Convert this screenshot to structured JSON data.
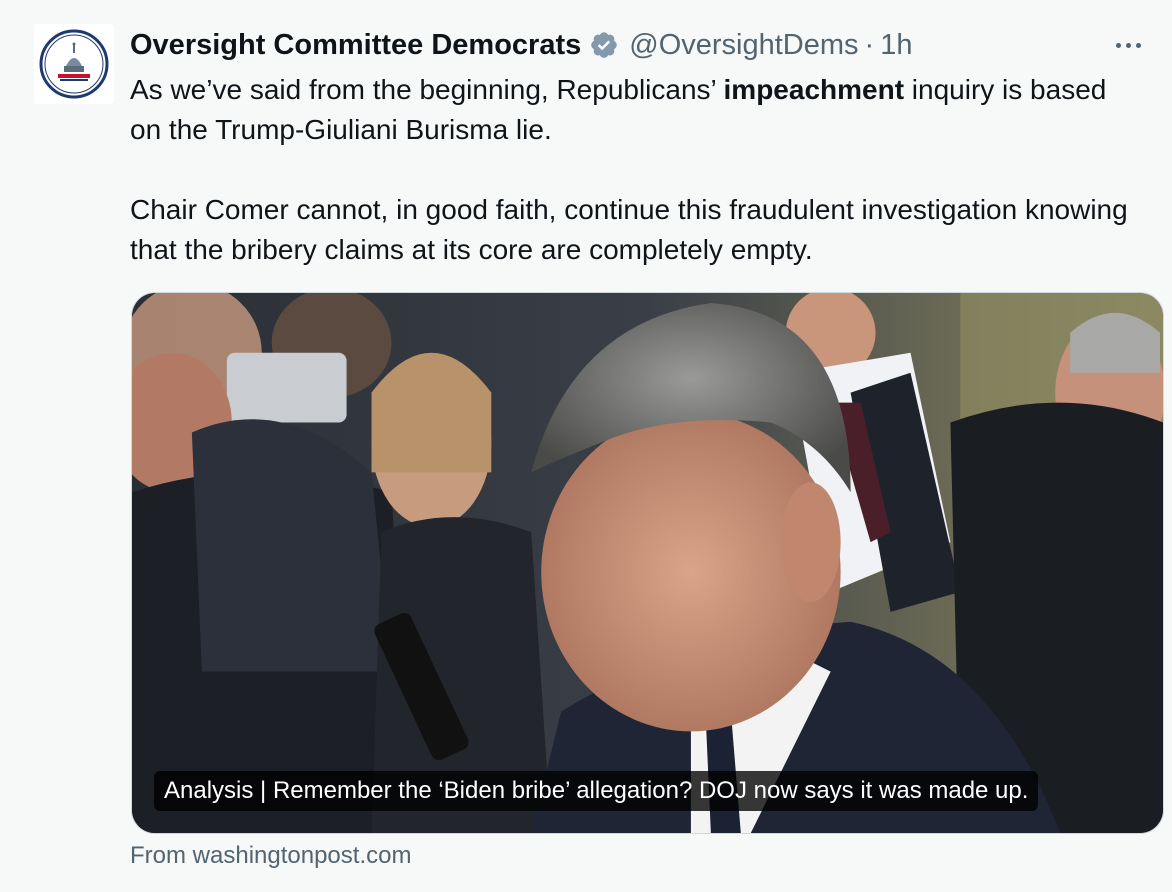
{
  "tweet": {
    "author": {
      "display_name": "Oversight Committee Democrats",
      "handle": "@OversightDems",
      "verified": true,
      "avatar_icon": "capitol-dome-seal-icon"
    },
    "separator": "·",
    "time": "1h",
    "text": {
      "para1_pre": "As we’ve said from the beginning, Republicans’ ",
      "para1_bold": "impeachment",
      "para1_post": " inquiry is based on the Trump-Giuliani Burisma lie.",
      "para2": "Chair Comer cannot, in good faith, continue this fraudulent investigation knowing that the bribery claims at its core are completely empty."
    },
    "card": {
      "title": "Analysis | Remember the ‘Biden bribe’ allegation? DOJ now says it was made up.",
      "source": "From washingtonpost.com"
    }
  },
  "colors": {
    "background": "#f7f9f9",
    "text_primary": "#0f1419",
    "text_secondary": "#536471",
    "verified_badge": "#829aab"
  }
}
